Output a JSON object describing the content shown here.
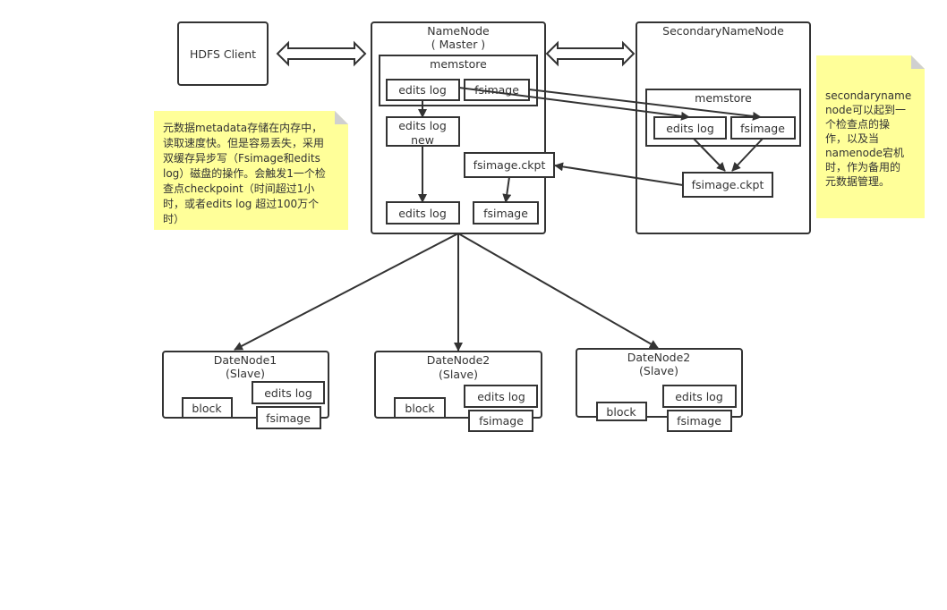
{
  "client": {
    "label": "HDFS Client"
  },
  "namenode": {
    "title": "NameNode",
    "subtitle": "( Master )",
    "memstore": "memstore",
    "edits_log": "edits log",
    "fsimage": "fsimage",
    "edits_log_new": [
      "edits log",
      "new"
    ],
    "fsimage_ckpt": "fsimage.ckpt",
    "disk_edits_log": "edits log",
    "disk_fsimage": "fsimage"
  },
  "secondary": {
    "title": "SecondaryNameNode",
    "memstore": "memstore",
    "edits_log": "edits log",
    "fsimage": "fsimage",
    "fsimage_ckpt": "fsimage.ckpt"
  },
  "notes": {
    "left": [
      "元数据metadata存储在内存中，",
      "读取速度快。但是容易丢失，采用",
      "双缓存异步写（Fsimage和edits",
      "log）磁盘的操作。会触发1一个检",
      "查点checkpoint（时间超过1小",
      "时，或者edits log 超过100万个",
      "时）"
    ],
    "right": [
      "secondaryname",
      "node可以起到一",
      "个检查点的操",
      "作，以及当",
      "namenode宕机",
      "时，作为备用的",
      "元数据管理。"
    ]
  },
  "datanodes": [
    {
      "title": "DateNode1",
      "subtitle": "(Slave)",
      "edits_log": "edits log",
      "block": "block",
      "fsimage": "fsimage"
    },
    {
      "title": "DateNode2",
      "subtitle": "(Slave)",
      "edits_log": "edits log",
      "block": "block",
      "fsimage": "fsimage"
    },
    {
      "title": "DateNode2",
      "subtitle": "(Slave)",
      "edits_log": "edits log",
      "block": "block",
      "fsimage": "fsimage"
    }
  ],
  "colors": {
    "note": "#ffff99",
    "stroke": "#333333"
  }
}
